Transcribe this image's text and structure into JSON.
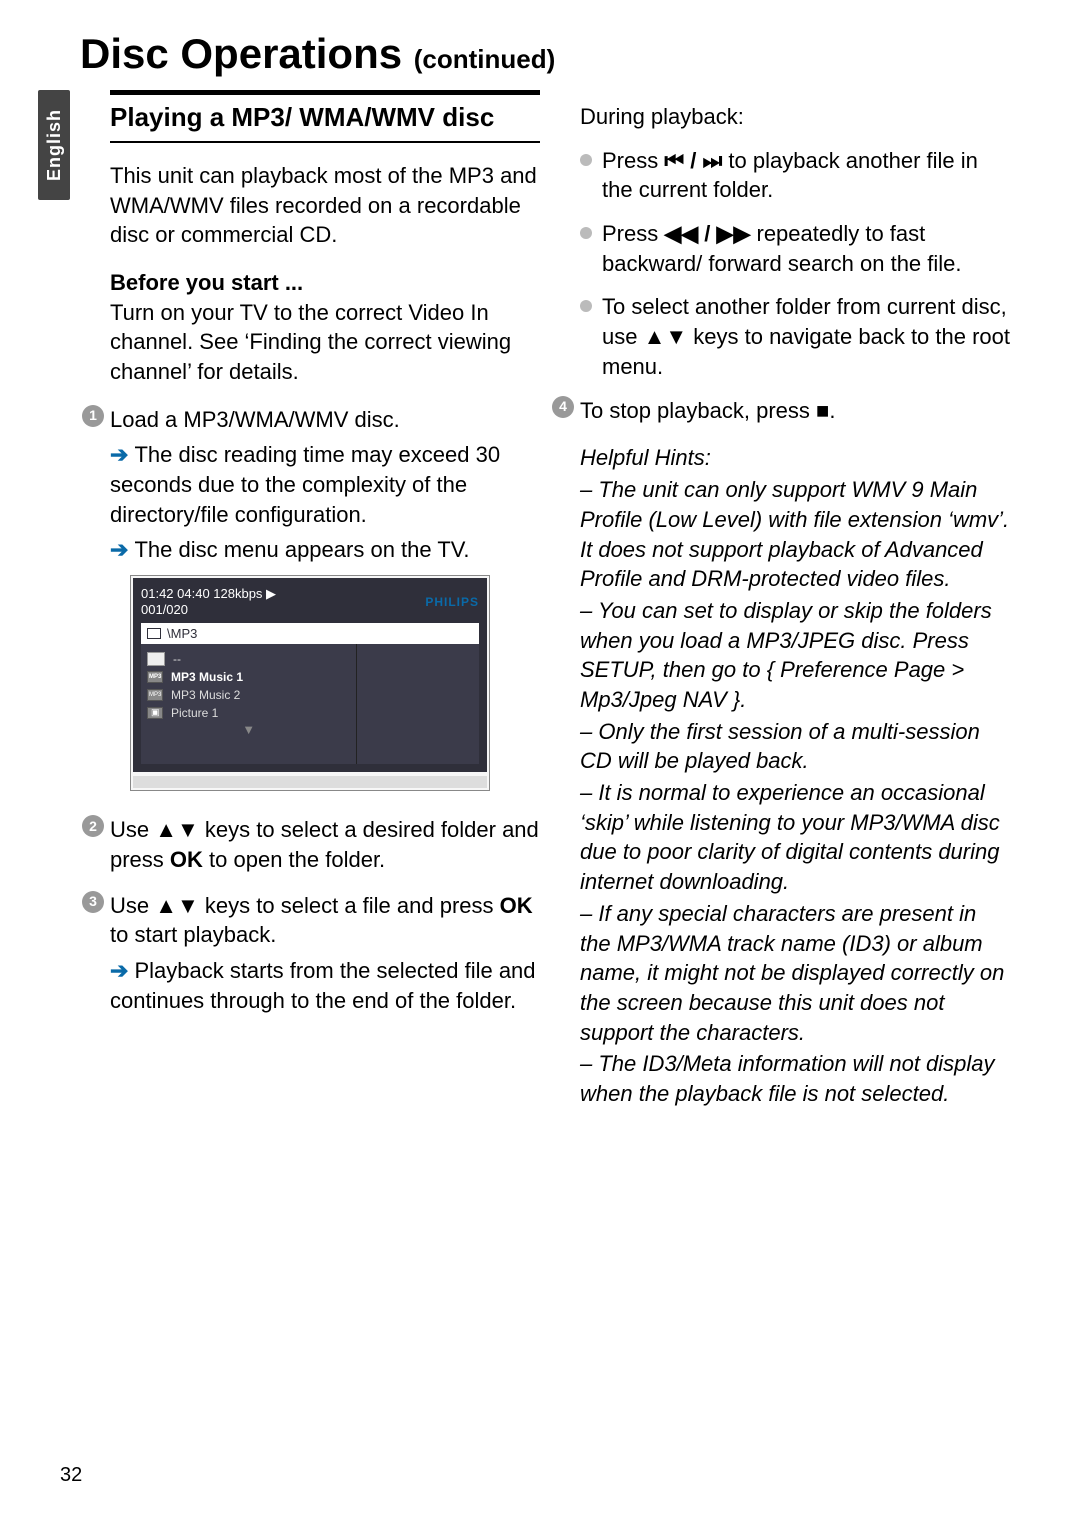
{
  "page": {
    "number": "32",
    "lang_tab": "English",
    "heading_main": "Disc Operations ",
    "heading_cont": "(continued)"
  },
  "left": {
    "section_title": "Playing a MP3/ WMA/WMV disc",
    "intro": "This unit can playback most of the MP3 and WMA/WMV files recorded on a recordable disc or commercial CD.",
    "before_label": "Before you start ...",
    "before_text": "Turn on your TV to the correct Video In channel. See ‘Finding the correct viewing channel’ for details.",
    "step1_main": "Load a MP3/WMA/WMV disc.",
    "step1_sub1": "The disc reading time may exceed 30 seconds due to the complexity of the directory/file configuration.",
    "step1_sub2": "The disc menu appears on the TV.",
    "step2_main_a": "Use ",
    "step2_main_b": " keys to select a desired folder and press ",
    "step2_main_c": " to open the folder.",
    "step2_ok": "OK",
    "step3_main_a": "Use ",
    "step3_main_b": " keys to select a file and press ",
    "step3_main_c": " to start playback.",
    "step3_ok": "OK",
    "step3_sub": "Playback starts from the selected file and continues through to the end of the folder."
  },
  "right": {
    "during": "During playback:",
    "b1_a": "Press ",
    "b1_b": " to playback another file in the current folder.",
    "b2_a": "Press ",
    "b2_b": " repeatedly to fast backward/ forward search on the file.",
    "b3_a": "To select another folder from current disc, use ",
    "b3_b": " keys to navigate back to the root menu.",
    "step4_a": "To stop playback, press ",
    "step4_b": ".",
    "hints_title": "Helpful Hints:",
    "h1": "–   The unit can only support WMV 9 Main Profile (Low Level) with file extension ‘wmv’. It does not support playback of Advanced Profile and DRM-protected video files.",
    "h2": "–   You can set to display or skip the folders when you load a MP3/JPEG disc. Press SETUP, then go to { Preference Page > Mp3/Jpeg NAV }.",
    "h3": "–   Only the first session of a multi-session CD will be played back.",
    "h4": "–   It is normal to experience an occasional ‘skip’ while listening to your MP3/WMA disc due to poor clarity of digital contents during internet downloading.",
    "h5": "–   If any special characters are present in the MP3/WMA track name (ID3) or album name, it might not be displayed correctly on the screen because this unit does not support the characters.",
    "h6": "–   The ID3/Meta information will not display when the playback file is not selected."
  },
  "tv": {
    "time_row": "01:42   04:40   128kbps   ▶",
    "count": "001/020",
    "brand": "PHILIPS",
    "path": "\\MP3",
    "r1": "--",
    "r2": "MP3 Music 1",
    "r3": "MP3 Music 2",
    "r4": "Picture 1"
  },
  "sym": {
    "updown": "▲▼",
    "prevnext": "⏮ / ⏭",
    "rewff": "◀◀ / ▶▶",
    "stop": "■"
  }
}
